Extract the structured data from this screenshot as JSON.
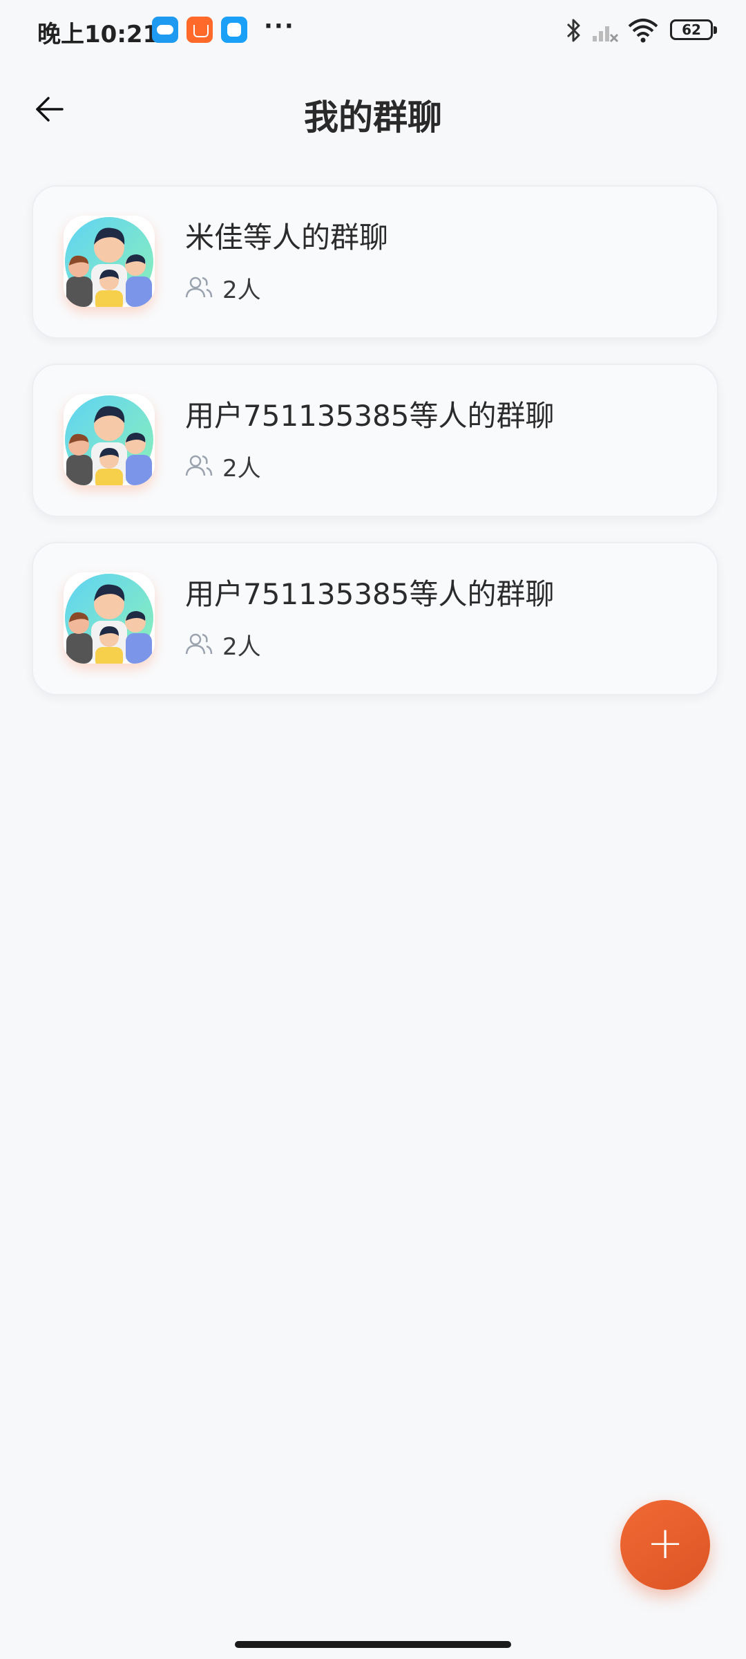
{
  "status_bar": {
    "time": "晚上10:21",
    "more": "···",
    "battery": "62"
  },
  "header": {
    "title": "我的群聊"
  },
  "groups": [
    {
      "name": "米佳等人的群聊",
      "members": "2人"
    },
    {
      "name": "用户751135385等人的群聊",
      "members": "2人"
    },
    {
      "name": "用户751135385等人的群聊",
      "members": "2人"
    }
  ],
  "fab": {
    "label": "+"
  },
  "icons": {
    "back": "back-arrow-icon",
    "members": "people-icon",
    "add": "plus-icon"
  },
  "colors": {
    "accent": "#e85d2c",
    "background": "#f7f8fa",
    "card": "#f9fafc"
  }
}
